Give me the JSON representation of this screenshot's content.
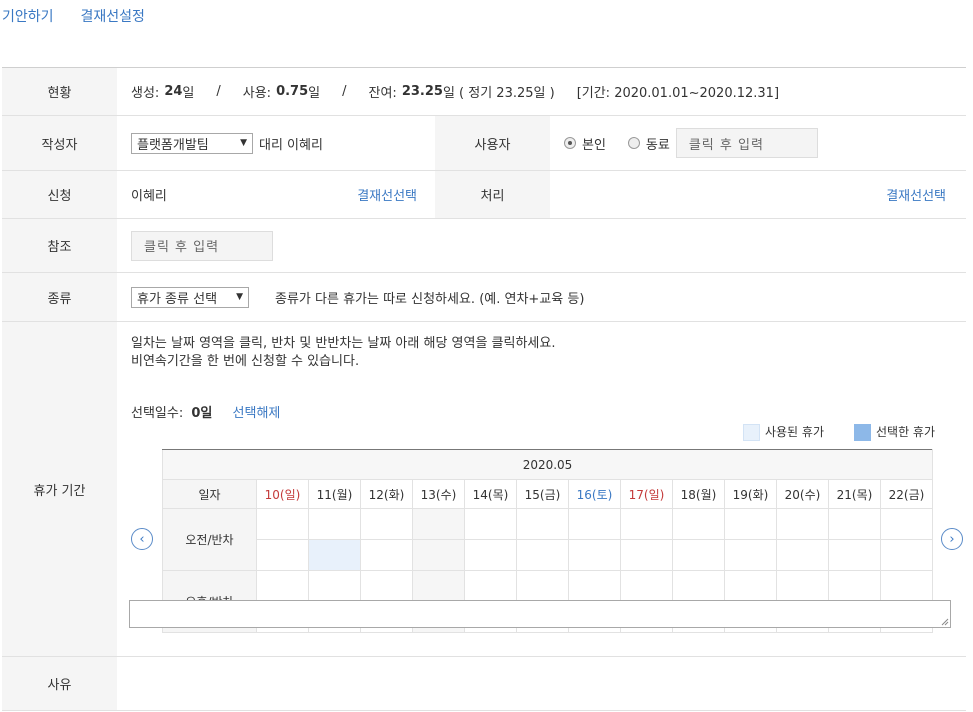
{
  "tabs": [
    "기안하기",
    "결재선설정"
  ],
  "status": {
    "label": "현황",
    "created_label": "생성:",
    "created_value": "24",
    "created_unit": "일",
    "sep1": "/",
    "used_label": "사용:",
    "used_value": "0.75",
    "used_unit": "일",
    "sep2": "/",
    "remain_label": "잔여:",
    "remain_value": "23.25",
    "remain_detail": "일 ( 정기 23.25일 )",
    "period": "[기간: 2020.01.01~2020.12.31]"
  },
  "author": {
    "label": "작성자",
    "dept": "플랫폼개발팀",
    "name": "대리 이혜리",
    "user_label": "사용자",
    "radio_self": "본인",
    "radio_colleague": "동료",
    "user_placeholder": "클릭 후 입력"
  },
  "request": {
    "label": "신청",
    "name": "이혜리",
    "select_link": "결재선선택",
    "process_label": "처리",
    "process_link": "결재선선택"
  },
  "reference": {
    "label": "참조",
    "placeholder": "클릭 후 입력"
  },
  "kind": {
    "label": "종류",
    "select": "휴가 종류 선택",
    "note": "종류가 다른 휴가는 따로 신청하세요. (예. 연차+교육 등)"
  },
  "period": {
    "label": "휴가 기간",
    "help1": "일차는 날짜 영역을 클릭, 반차 및 반반차는 날짜 아래 해당 영역을 클릭하세요.",
    "help2": "비연속기간을 한 번에 신청할 수 있습니다.",
    "selected_label": "선택일수:",
    "selected_value": "0일",
    "clear_link": "선택해제",
    "legend_used": "사용된 휴가",
    "legend_selected": "선택한 휴가",
    "colors": {
      "used": "#e8f1fb",
      "selected": "#8db8e8"
    },
    "month": "2020.05",
    "day_label": "일자",
    "days": [
      {
        "text": "10(일)",
        "kind": "sun"
      },
      {
        "text": "11(월)",
        "kind": ""
      },
      {
        "text": "12(화)",
        "kind": ""
      },
      {
        "text": "13(수)",
        "kind": ""
      },
      {
        "text": "14(목)",
        "kind": ""
      },
      {
        "text": "15(금)",
        "kind": ""
      },
      {
        "text": "16(토)",
        "kind": "sat"
      },
      {
        "text": "17(일)",
        "kind": "sun"
      },
      {
        "text": "18(월)",
        "kind": ""
      },
      {
        "text": "19(화)",
        "kind": ""
      },
      {
        "text": "20(수)",
        "kind": ""
      },
      {
        "text": "21(목)",
        "kind": ""
      },
      {
        "text": "22(금)",
        "kind": ""
      }
    ],
    "am_label": "오전/반차",
    "pm_label": "오후/반차",
    "prev_icon": "chevron-left-icon",
    "next_icon": "chevron-right-icon"
  },
  "reason": {
    "label": "사유"
  }
}
